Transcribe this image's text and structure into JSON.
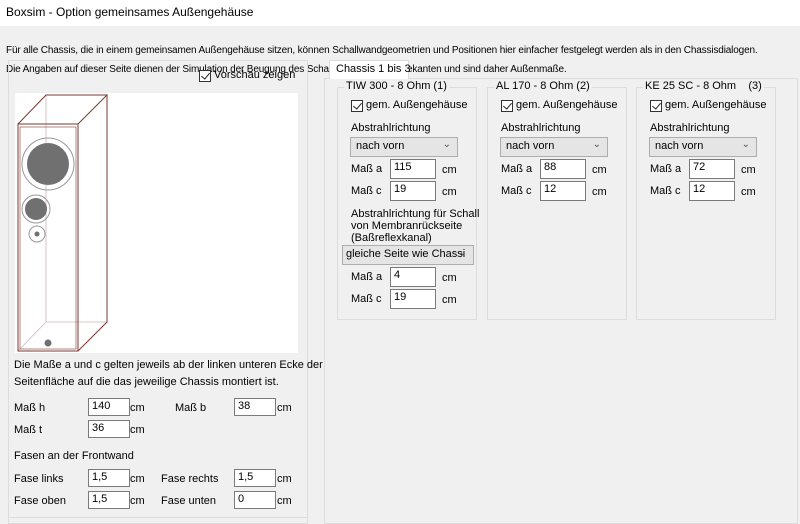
{
  "window": {
    "title": "Boxsim - Option gemeinsames Außengehäuse"
  },
  "intro": [
    "Für alle Chassis, die in einem gemeinsamen Außengehäuse sitzen, können Schallwandgeometrien und Positionen hier einfacher festgelegt werden als in den Chassisdialogen.",
    "Die Angaben auf dieser Seite dienen der Simulation der  Beugung des Schalls an den Gehäusekanten und sind daher Außenmaße."
  ],
  "preview": {
    "checkbox_label": "Vorschau zeigen",
    "checked": true
  },
  "note": [
    "Die Maße a und c gelten jeweils ab der linken unteren Ecke der",
    "Seitenfläche auf die das jeweilige Chassis montiert ist."
  ],
  "dims": {
    "h_label": "Maß h",
    "h": "140",
    "b_label": "Maß b",
    "b": "38",
    "t_label": "Maß t",
    "t": "36",
    "unit": "cm"
  },
  "fasen": {
    "heading": "Fasen an der Frontwand",
    "links_label": "Fase links",
    "links": "1,5",
    "rechts_label": "Fase rechts",
    "rechts": "1,5",
    "oben_label": "Fase oben",
    "oben": "1,5",
    "unten_label": "Fase unten",
    "unten": "0"
  },
  "tab": {
    "label": "Chassis 1 bis 3"
  },
  "chassis": [
    {
      "title": "TIW 300 - 8 Ohm (1)",
      "checkbox": "gem. Außengehäuse",
      "dir_label": "Abstrahlrichtung",
      "dir": "nach vorn",
      "a_label": "Maß a",
      "a": "115",
      "c_label": "Maß c",
      "c": "19",
      "unit": "cm",
      "rear_label": [
        "Abstrahlrichtung für Schall",
        "von Membranrückseite",
        "(Baßreflexkanal)"
      ],
      "rear_dir": "gleiche Seite wie Chassi",
      "rear_a": "4",
      "rear_c": "19"
    },
    {
      "title": "AL 170 - 8 Ohm (2)",
      "checkbox": "gem. Außengehäuse",
      "dir_label": "Abstrahlrichtung",
      "dir": "nach vorn",
      "a_label": "Maß a",
      "a": "88",
      "c_label": "Maß c",
      "c": "12",
      "unit": "cm"
    },
    {
      "title": "KE 25 SC - 8 Ohm    (3)",
      "checkbox": "gem. Außengehäuse",
      "dir_label": "Abstrahlrichtung",
      "dir": "nach vorn",
      "a_label": "Maß a",
      "a": "72",
      "c_label": "Maß c",
      "c": "12",
      "unit": "cm"
    }
  ]
}
